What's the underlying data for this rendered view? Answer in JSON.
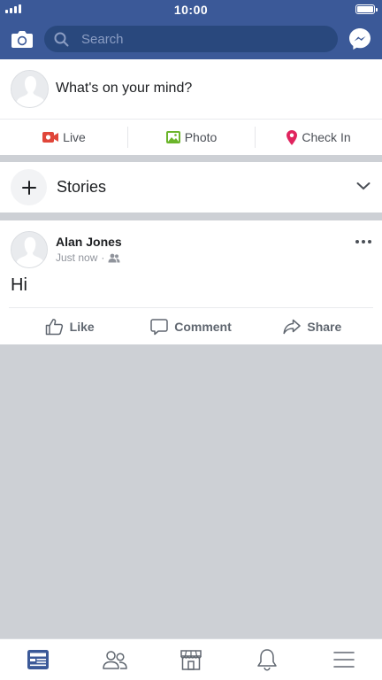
{
  "status_bar": {
    "time": "10:00"
  },
  "header": {
    "camera_icon": "camera-icon",
    "search_placeholder": "Search",
    "messenger_icon": "messenger-icon",
    "brand_color": "#3b5998"
  },
  "composer": {
    "prompt": "What's on your mind?",
    "actions": [
      {
        "label": "Live",
        "icon": "live-video-icon",
        "color": "#e0463a"
      },
      {
        "label": "Photo",
        "icon": "photo-icon",
        "color": "#6bb52b"
      },
      {
        "label": "Check In",
        "icon": "location-pin-icon",
        "color": "#e0245e"
      }
    ]
  },
  "stories": {
    "title": "Stories"
  },
  "post": {
    "author": "Alan Jones",
    "time": "Just now",
    "text": "Hi",
    "actions": [
      {
        "label": "Like",
        "icon": "thumbs-up-icon"
      },
      {
        "label": "Comment",
        "icon": "comment-icon"
      },
      {
        "label": "Share",
        "icon": "share-icon"
      }
    ]
  },
  "tab_bar": {
    "tabs": [
      "news-feed-icon",
      "friends-icon",
      "marketplace-icon",
      "notifications-icon",
      "menu-icon"
    ],
    "active_tab": "news-feed-icon",
    "active_color": "#3b5998"
  }
}
